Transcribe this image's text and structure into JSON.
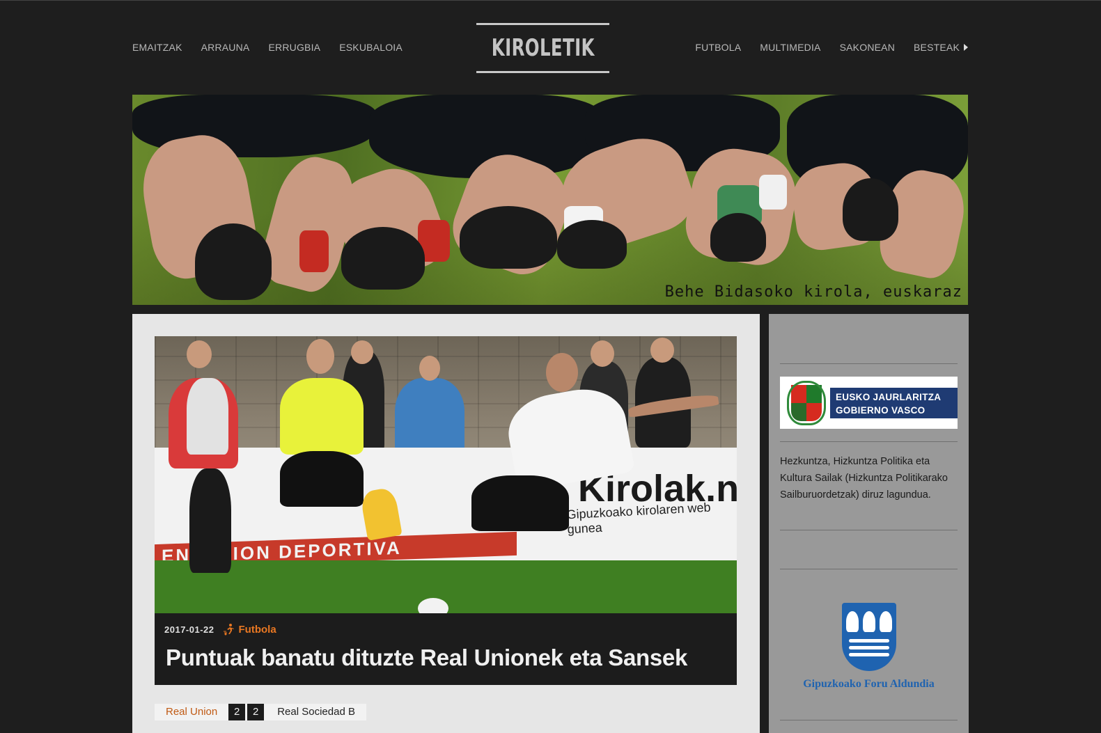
{
  "header": {
    "logo_text": "KIROLETIK",
    "nav_left": [
      "EMAITZAK",
      "ARRAUNA",
      "ERRUGBIA",
      "ESKUBALOIA"
    ],
    "nav_right": [
      "FUTBOLA",
      "MULTIMEDIA",
      "SAKONEAN",
      "BESTEAK"
    ]
  },
  "banner": {
    "tagline": "Behe Bidasoko kirola, euskaraz"
  },
  "article": {
    "date": "2017-01-22",
    "category": "Futbola",
    "category_color": "#e87722",
    "category_icon": "football-player-icon",
    "headline": "Puntuak banatu dituzte Real Unionek eta Sansek",
    "image_text": {
      "board_brand": "Kirolak.net",
      "board_sub": "Gipuzkoako kirolaren web gunea",
      "board_red": "ENTACION DEPORTIVA"
    }
  },
  "score": {
    "home_team": "Real Union",
    "home_goals": "2",
    "away_goals": "2",
    "away_team": "Real Sociedad B"
  },
  "sidebar": {
    "sponsor1_line1": "EUSKO JAURLARITZA",
    "sponsor1_line2": "GOBIERNO VASCO",
    "funding_text": "Hezkuntza, Hizkuntza Politika eta Kultura Sailak (Hizkuntza Politikarako Sailburuordetzak) diruz lagundua.",
    "sponsor2_name": "Gipuzkoako Foru Aldundia"
  },
  "colors": {
    "background": "#1e1e1e",
    "main_panel": "#e6e6e6",
    "sidebar_panel": "#999999",
    "accent": "#e87722"
  }
}
